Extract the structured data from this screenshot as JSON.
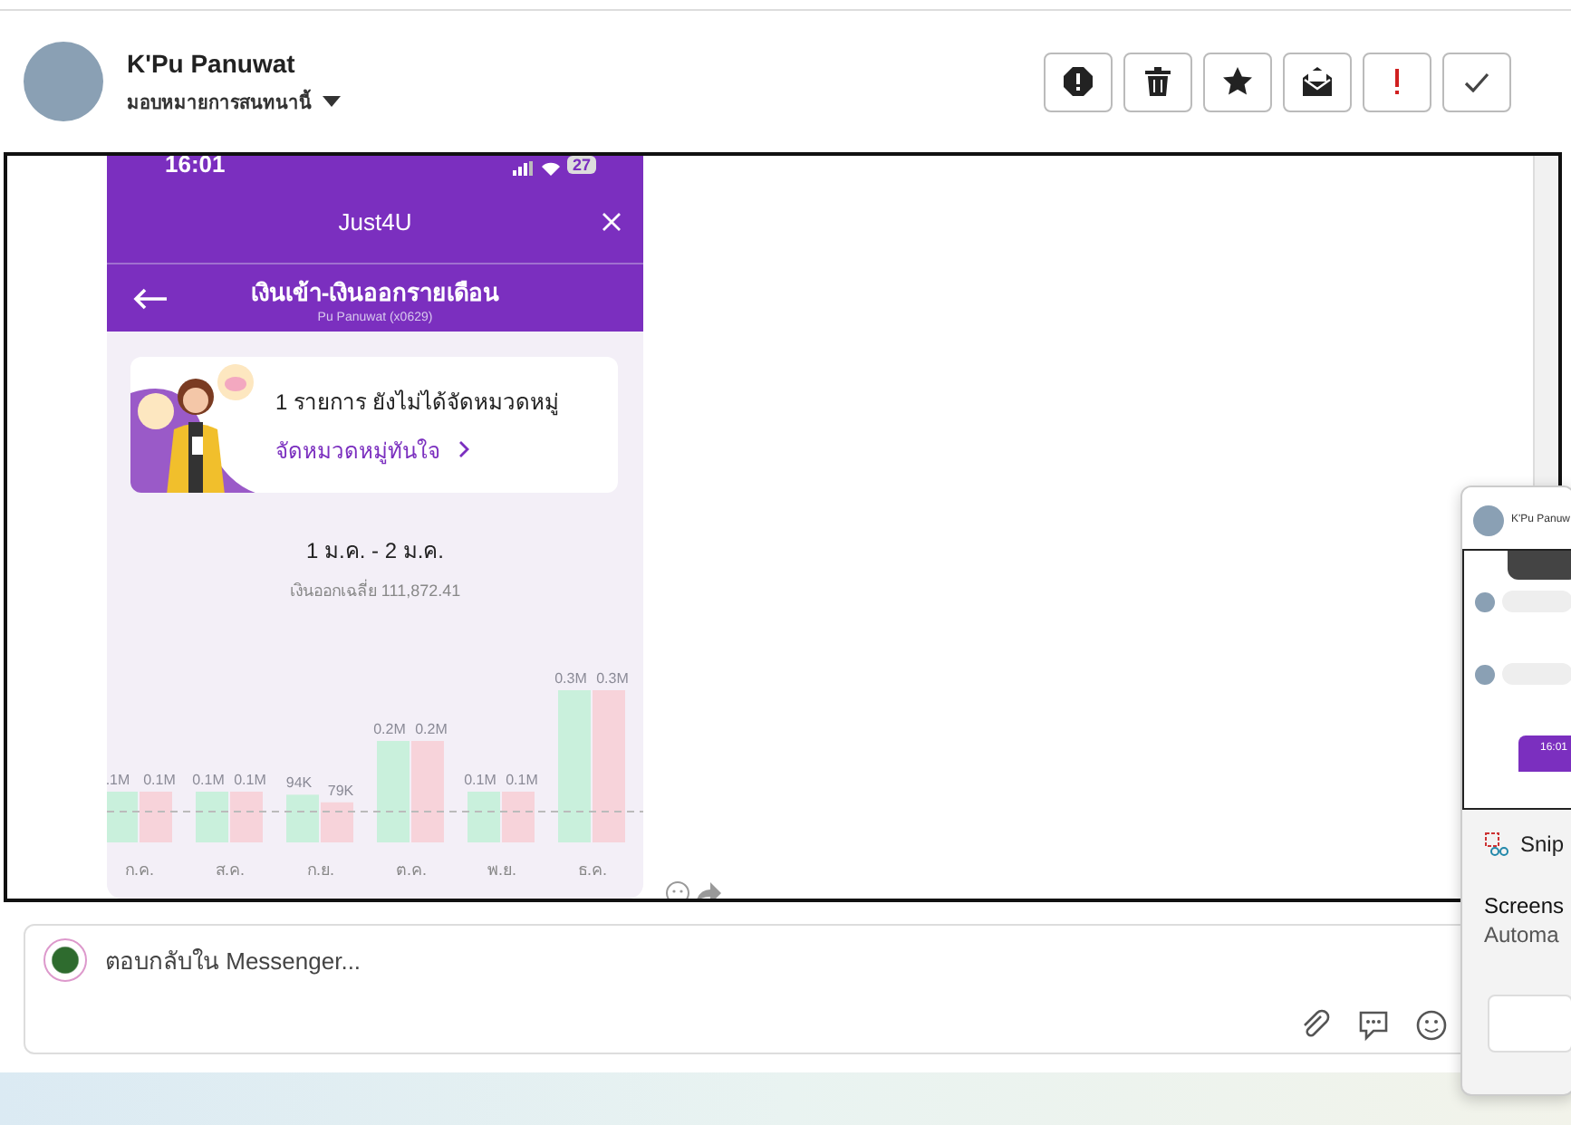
{
  "header": {
    "name": "K'Pu Panuwat",
    "assign_label": "มอบหมายการสนทนานี้"
  },
  "toolbar": [
    {
      "kind": "spam"
    },
    {
      "kind": "delete"
    },
    {
      "kind": "star"
    },
    {
      "kind": "unread"
    },
    {
      "kind": "important"
    },
    {
      "kind": "done"
    }
  ],
  "message": {
    "screenshot": {
      "status_time": "16:01",
      "battery": "27",
      "app_title": "Just4U",
      "page_title": "เงินเข้า-เงินออกรายเดือน",
      "account": "Pu Panuwat (x0629)",
      "notice": "1 รายการ ยังไม่ได้จัดหมวดหมู่",
      "notice_link": "จัดหมวดหมู่ทันใจ",
      "date_range": "1 ม.ค. - 2 ม.ค.",
      "average_label": "เงินออกเฉลี่ย 111,872.41",
      "chart_data": {
        "type": "bar",
        "categories": [
          "ก.ค.",
          "ส.ค.",
          "ก.ย.",
          "ต.ค.",
          "พ.ย.",
          "ธ.ค."
        ],
        "series": [
          {
            "color": "#c9f0dc",
            "values": [
              100000,
              100000,
              94000,
              200000,
              100000,
              300000
            ],
            "value_labels": [
              ".1M",
              "0.1M",
              "94K",
              "0.2M",
              "0.1M",
              "0.3M"
            ]
          },
          {
            "color": "#f7d3da",
            "values": [
              100000,
              100000,
              79000,
              200000,
              100000,
              300000
            ],
            "value_labels": [
              "0.1M",
              "0.1M",
              "79K",
              "0.2M",
              "0.1M",
              "0.3M"
            ]
          }
        ]
      }
    }
  },
  "reply": {
    "placeholder": "ตอบกลับใน Messenger..."
  },
  "notification": {
    "thumbnail": {
      "name": "K'Pu Panuw",
      "time": "16:01"
    },
    "app": "Snip",
    "title": "Screens",
    "body": "Automa"
  }
}
